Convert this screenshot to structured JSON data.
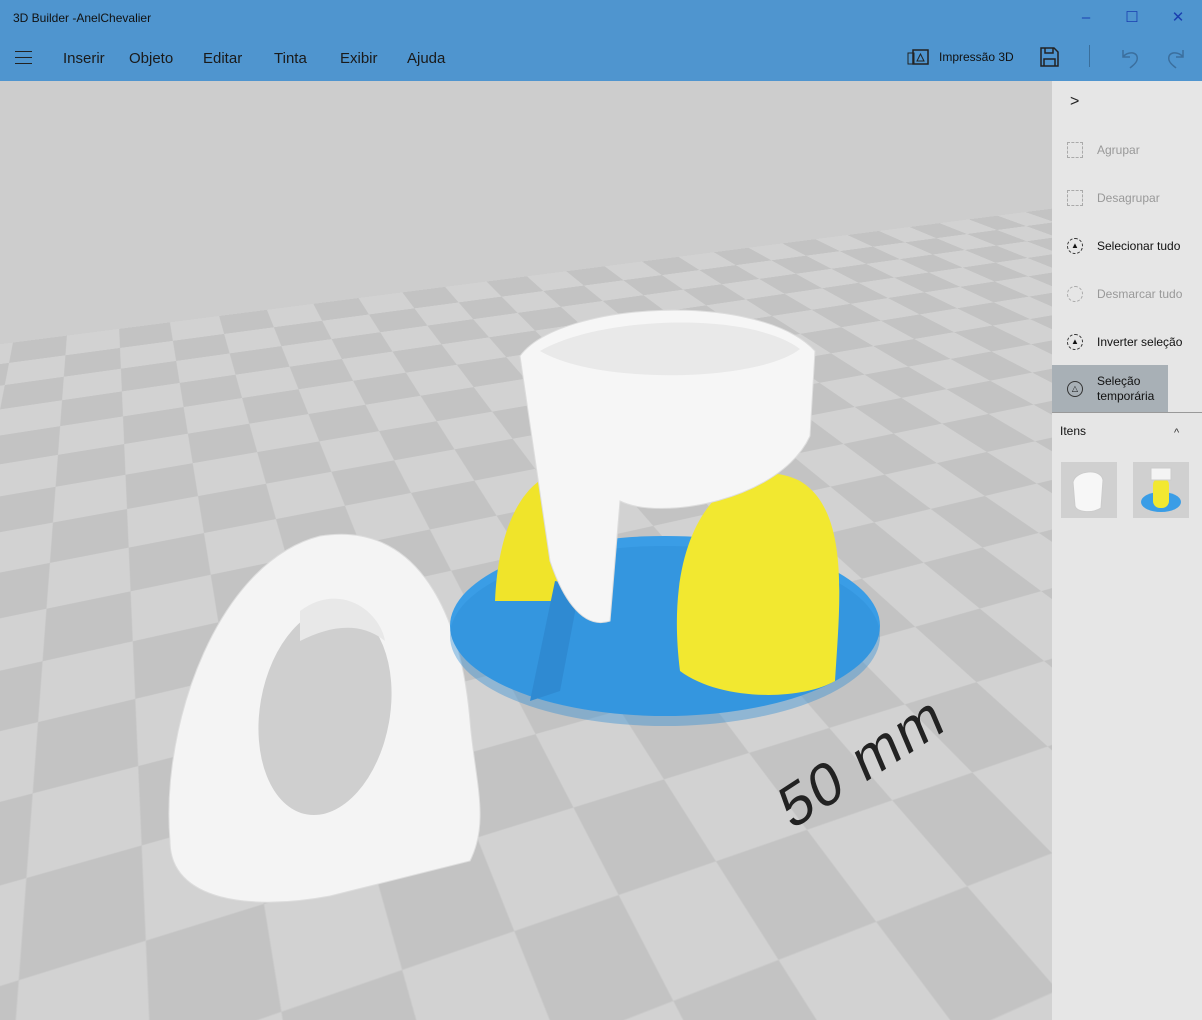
{
  "window": {
    "title": "3D Builder -AnelChevalier",
    "minimize": "–",
    "maximize": "☐",
    "close": "✕"
  },
  "menu": {
    "items": [
      "Inserir",
      "Objeto",
      "Editar",
      "Tinta",
      "Exibir",
      "Ajuda"
    ],
    "print_label": "Impressão 3D",
    "save_icon": "save-icon",
    "undo_icon": "undo-icon",
    "redo_icon": "redo-icon"
  },
  "panel": {
    "collapse": ">",
    "items": [
      {
        "label": "Agrupar",
        "enabled": false
      },
      {
        "label": "Desagrupar",
        "enabled": false
      },
      {
        "label": "Selecionar tudo",
        "enabled": true
      },
      {
        "label": "Desmarcar tudo",
        "enabled": false
      },
      {
        "label": "Inverter seleção",
        "enabled": true
      },
      {
        "label": "Seleção temporária",
        "enabled": true,
        "active": true
      }
    ],
    "items_header": "Itens",
    "items_toggle": "^"
  },
  "viewport": {
    "scale_label": "50 mm"
  },
  "colors": {
    "accent": "#4f95cf",
    "blue_part": "#3fa0e6",
    "yellow_part": "#f2e830"
  }
}
